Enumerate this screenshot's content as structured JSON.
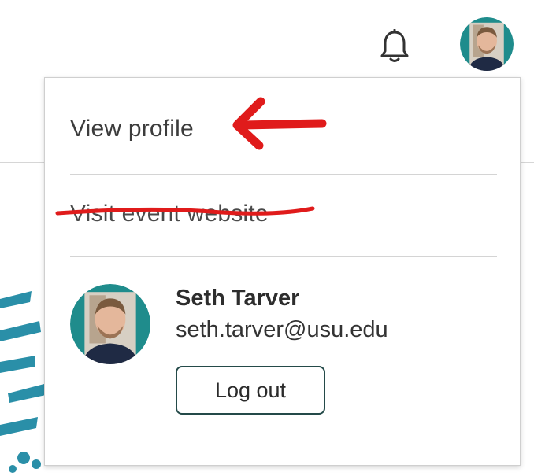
{
  "header": {
    "notifications_icon": "bell-icon",
    "avatar_icon": "user-avatar"
  },
  "menu": {
    "items": [
      {
        "label": "View profile",
        "annotation": "red-arrow"
      },
      {
        "label": "Visit event website",
        "annotation": "red-strikethrough"
      }
    ]
  },
  "user": {
    "name": "Seth Tarver",
    "email": "seth.tarver@usu.edu",
    "logout_label": "Log out"
  },
  "colors": {
    "accent_teal": "#1f8c8c",
    "button_border": "#244a49",
    "annotation_red": "#e01b1b"
  }
}
